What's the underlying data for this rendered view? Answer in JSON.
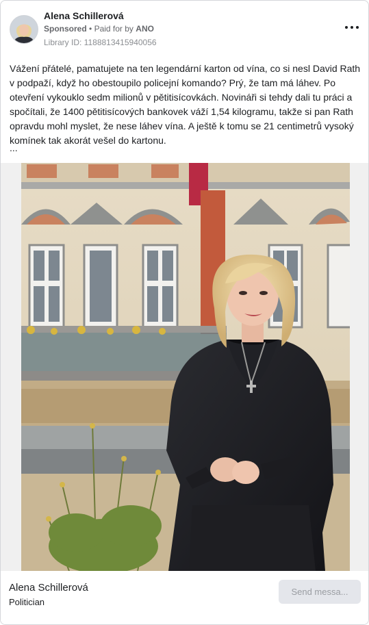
{
  "ad": {
    "page_name": "Alena Schillerová",
    "sponsored": "Sponsored",
    "separator": "•",
    "paid_for_by_prefix": "Paid for by",
    "payer": "ANO",
    "library_id": "Library ID: 1188813415940056",
    "body": "Vážení přátelé, pamatujete na ten legendární karton od vína, co si nesl David Rath v podpaží, když ho obestoupilo policejní komando? Prý, že tam má láhev. Po otevření vykouklo sedm milionů v pětitisícovkách. Novináři si tehdy dali tu práci a spočítali, že 1400 pětitisícových bankovek váží 1,54 kilogramu, takže si pan Rath opravdu mohl myslet, že nese láhev vína. A ještě k tomu se 21 centimetrů vysoký komínek tak akorát vešel do kartonu.",
    "see_more": "...",
    "more_options_icon": "more-horizontal-icon",
    "avatar_icon": "profile-photo"
  },
  "footer": {
    "name": "Alena Schillerová",
    "role": "Politician",
    "send_button": "Send messa..."
  },
  "colors": {
    "text_primary": "#1c1e21",
    "text_secondary": "#65676b",
    "button_bg": "#e4e6eb",
    "media_bg": "#f0f0f0"
  }
}
